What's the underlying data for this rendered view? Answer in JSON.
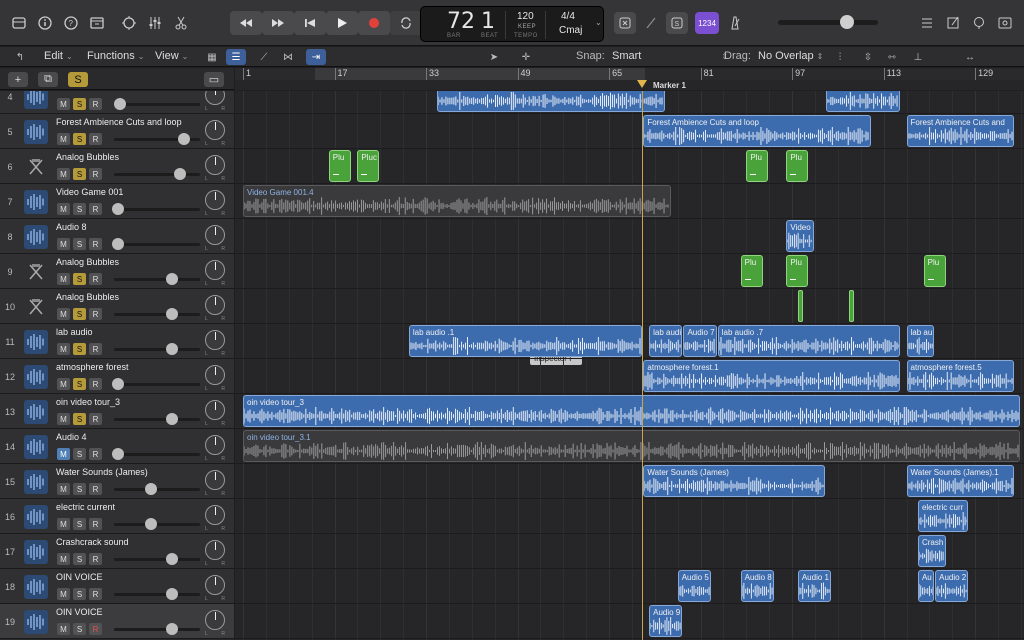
{
  "lcd": {
    "bar": "72",
    "beat": "1",
    "bar_label": "BAR",
    "beat_label": "BEAT",
    "tempo": "120",
    "keep": "KEEP",
    "tempo_label": "TEMPO",
    "signature": "4/4",
    "key": "Cmaj"
  },
  "key_button": "1234",
  "toolbar": {
    "edit": "Edit",
    "functions": "Functions",
    "view": "View",
    "snap_label": "Snap:",
    "snap_value": "Smart",
    "drag_label": "Drag:",
    "drag_value": "No Overlap"
  },
  "ruler": {
    "ticks": [
      "1",
      "17",
      "33",
      "49",
      "65",
      "81",
      "97",
      "113",
      "129"
    ],
    "marker": "Marker 1"
  },
  "tooltip": "Inspector  I",
  "tracks": [
    {
      "num": "4",
      "name": "",
      "type": "audio",
      "mute_active": false,
      "solo": true,
      "rec": false,
      "vol": 0.05
    },
    {
      "num": "5",
      "name": "Forest Ambience Cuts and loop",
      "type": "audio",
      "mute_active": false,
      "solo": true,
      "rec": false,
      "vol": 0.87
    },
    {
      "num": "6",
      "name": "Analog Bubbles",
      "type": "synth",
      "mute_active": false,
      "solo": true,
      "rec": false,
      "vol": 0.82
    },
    {
      "num": "7",
      "name": "Video Game 001",
      "type": "audio",
      "mute_active": false,
      "solo": false,
      "rec": false,
      "vol": 0.03
    },
    {
      "num": "8",
      "name": "Audio 8",
      "type": "audio",
      "mute_active": false,
      "solo": false,
      "rec": false,
      "vol": 0.03
    },
    {
      "num": "9",
      "name": "Analog Bubbles",
      "type": "synth",
      "mute_active": false,
      "solo": true,
      "rec": false,
      "vol": 0.72
    },
    {
      "num": "10",
      "name": "Analog Bubbles",
      "type": "synth",
      "mute_active": false,
      "solo": true,
      "rec": false,
      "vol": 0.72
    },
    {
      "num": "11",
      "name": "lab audio",
      "type": "audio",
      "mute_active": false,
      "solo": true,
      "rec": false,
      "vol": 0.72
    },
    {
      "num": "12",
      "name": "atmosphere forest",
      "type": "audio",
      "mute_active": false,
      "solo": true,
      "rec": false,
      "vol": 0.03
    },
    {
      "num": "13",
      "name": "oin video tour_3",
      "type": "audio",
      "mute_active": false,
      "solo": true,
      "rec": false,
      "vol": 0.72
    },
    {
      "num": "14",
      "name": "Audio 4",
      "type": "audio",
      "mute_active": true,
      "solo": false,
      "rec": false,
      "vol": 0.03
    },
    {
      "num": "15",
      "name": "Water Sounds (James)",
      "type": "audio",
      "mute_active": false,
      "solo": false,
      "rec": false,
      "vol": 0.45
    },
    {
      "num": "16",
      "name": "electric current",
      "type": "audio",
      "mute_active": false,
      "solo": false,
      "rec": false,
      "vol": 0.45
    },
    {
      "num": "17",
      "name": "Crashcrack sound",
      "type": "audio",
      "mute_active": false,
      "solo": false,
      "rec": false,
      "vol": 0.72
    },
    {
      "num": "18",
      "name": "OIN VOICE",
      "type": "audio",
      "mute_active": false,
      "solo": false,
      "rec": false,
      "vol": 0.72
    },
    {
      "num": "19",
      "name": "OIN VOICE",
      "type": "audio",
      "mute_active": false,
      "solo": false,
      "rec": true,
      "vol": 0.72,
      "selected": true
    }
  ],
  "regions": [
    {
      "lane": 0,
      "start": 35,
      "end": 75,
      "name": "",
      "kind": "audio"
    },
    {
      "lane": 0,
      "start": 103,
      "end": 116,
      "name": "",
      "kind": "audio"
    },
    {
      "lane": 1,
      "start": 71,
      "end": 111,
      "name": "Forest Ambience Cuts and loop",
      "kind": "audio"
    },
    {
      "lane": 1,
      "start": 117,
      "end": 136,
      "name": "Forest Ambience Cuts and",
      "kind": "audio"
    },
    {
      "lane": 2,
      "start": 16,
      "end": 20,
      "name": "Plu",
      "kind": "midi"
    },
    {
      "lane": 2,
      "start": 21,
      "end": 25,
      "name": "Pluc",
      "kind": "midi"
    },
    {
      "lane": 2,
      "start": 89,
      "end": 93,
      "name": "Plu",
      "kind": "midi"
    },
    {
      "lane": 2,
      "start": 96,
      "end": 100,
      "name": "Plu",
      "kind": "midi"
    },
    {
      "lane": 3,
      "start": 1,
      "end": 76,
      "name": "Video Game 001.4",
      "kind": "dark"
    },
    {
      "lane": 4,
      "start": 96,
      "end": 101,
      "name": "Video",
      "kind": "audio"
    },
    {
      "lane": 5,
      "start": 88,
      "end": 92,
      "name": "Plu",
      "kind": "midi"
    },
    {
      "lane": 5,
      "start": 96,
      "end": 100,
      "name": "Plu",
      "kind": "midi"
    },
    {
      "lane": 5,
      "start": 120,
      "end": 124,
      "name": "Plu",
      "kind": "midi"
    },
    {
      "lane": 7,
      "start": 30,
      "end": 71,
      "name": "lab audio .1",
      "kind": "audio"
    },
    {
      "lane": 7,
      "start": 72,
      "end": 78,
      "name": "lab audi",
      "kind": "audio"
    },
    {
      "lane": 7,
      "start": 78,
      "end": 84,
      "name": "Audio 7",
      "kind": "audio"
    },
    {
      "lane": 7,
      "start": 84,
      "end": 116,
      "name": "lab audio .7",
      "kind": "audio"
    },
    {
      "lane": 7,
      "start": 117,
      "end": 122,
      "name": "lab au",
      "kind": "audio"
    },
    {
      "lane": 8,
      "start": 71,
      "end": 116,
      "name": "atmosphere forest.1",
      "kind": "audio"
    },
    {
      "lane": 8,
      "start": 117,
      "end": 136,
      "name": "atmosphere forest.5",
      "kind": "audio"
    },
    {
      "lane": 9,
      "start": 1,
      "end": 137,
      "name": "oin video tour_3",
      "kind": "audio"
    },
    {
      "lane": 10,
      "start": 1,
      "end": 137,
      "name": "oin video tour_3.1",
      "kind": "dark"
    },
    {
      "lane": 11,
      "start": 71,
      "end": 103,
      "name": "Water Sounds (James)",
      "kind": "audio"
    },
    {
      "lane": 11,
      "start": 117,
      "end": 136,
      "name": "Water Sounds (James).1",
      "kind": "audio"
    },
    {
      "lane": 12,
      "start": 119,
      "end": 128,
      "name": "electric curr",
      "kind": "audio"
    },
    {
      "lane": 13,
      "start": 119,
      "end": 124,
      "name": "Crash",
      "kind": "audio"
    },
    {
      "lane": 14,
      "start": 77,
      "end": 83,
      "name": "Audio 5",
      "kind": "audio"
    },
    {
      "lane": 14,
      "start": 88,
      "end": 94,
      "name": "Audio 8",
      "kind": "audio"
    },
    {
      "lane": 14,
      "start": 98,
      "end": 104,
      "name": "Audio 1",
      "kind": "audio"
    },
    {
      "lane": 14,
      "start": 119,
      "end": 122,
      "name": "Au",
      "kind": "audio"
    },
    {
      "lane": 14,
      "start": 122,
      "end": 128,
      "name": "Audio 2",
      "kind": "audio"
    },
    {
      "lane": 15,
      "start": 72,
      "end": 78,
      "name": "Audio 9",
      "kind": "audio"
    }
  ]
}
